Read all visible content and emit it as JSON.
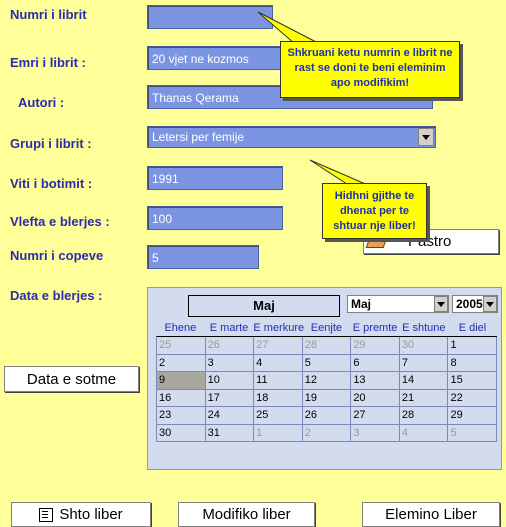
{
  "form": {
    "book_number_label": "Numri i  librit",
    "book_number_value": "",
    "book_name_label": "Emri i librit :",
    "book_name_value": "20 vjet ne kozmos",
    "author_label": "Autori :",
    "author_value": "Thanas Qerama",
    "group_label": "Grupi i librit :",
    "group_value": "Letersi per femije",
    "year_label": "Viti i botimit :",
    "year_value": "1991",
    "price_label": "Vlefta e blerjes :",
    "price_value": "100",
    "copies_label": "Numri i copeve",
    "copies_value": "5",
    "purchase_date_label": "Data e blerjes :"
  },
  "tooltips": {
    "top": "Shkruani ketu numrin e librit ne rast se doni te beni eleminim apo modifikim!",
    "bottom": "Hidhni gjithe te dhenat per te shtuar nje liber!"
  },
  "buttons": {
    "clear": "Pastro",
    "today": "Data e sotme",
    "add": "Shto liber",
    "modify": "Modifiko liber",
    "delete": "Elemino  Liber"
  },
  "calendar": {
    "title": "Maj",
    "month_select": "Maj",
    "year_select": "2005",
    "weekdays": [
      "Ehene",
      "E marte",
      "E merkure",
      "Eenjte",
      "E premte",
      "E shtune",
      "E diel"
    ],
    "weeks": [
      [
        {
          "d": "25",
          "o": true
        },
        {
          "d": "26",
          "o": true
        },
        {
          "d": "27",
          "o": true
        },
        {
          "d": "28",
          "o": true
        },
        {
          "d": "29",
          "o": true
        },
        {
          "d": "30",
          "o": true
        },
        {
          "d": "1",
          "o": false
        }
      ],
      [
        {
          "d": "2",
          "o": false
        },
        {
          "d": "3",
          "o": false
        },
        {
          "d": "4",
          "o": false
        },
        {
          "d": "5",
          "o": false
        },
        {
          "d": "6",
          "o": false
        },
        {
          "d": "7",
          "o": false
        },
        {
          "d": "8",
          "o": false
        }
      ],
      [
        {
          "d": "9",
          "o": false,
          "s": true
        },
        {
          "d": "10",
          "o": false
        },
        {
          "d": "11",
          "o": false
        },
        {
          "d": "12",
          "o": false
        },
        {
          "d": "13",
          "o": false
        },
        {
          "d": "14",
          "o": false
        },
        {
          "d": "15",
          "o": false
        }
      ],
      [
        {
          "d": "16",
          "o": false
        },
        {
          "d": "17",
          "o": false
        },
        {
          "d": "18",
          "o": false
        },
        {
          "d": "19",
          "o": false
        },
        {
          "d": "20",
          "o": false
        },
        {
          "d": "21",
          "o": false
        },
        {
          "d": "22",
          "o": false
        }
      ],
      [
        {
          "d": "23",
          "o": false
        },
        {
          "d": "24",
          "o": false
        },
        {
          "d": "25",
          "o": false
        },
        {
          "d": "26",
          "o": false
        },
        {
          "d": "27",
          "o": false
        },
        {
          "d": "28",
          "o": false
        },
        {
          "d": "29",
          "o": false
        }
      ],
      [
        {
          "d": "30",
          "o": false
        },
        {
          "d": "31",
          "o": false
        },
        {
          "d": "1",
          "o": true
        },
        {
          "d": "2",
          "o": true
        },
        {
          "d": "3",
          "o": true
        },
        {
          "d": "4",
          "o": true
        },
        {
          "d": "5",
          "o": true
        }
      ]
    ]
  },
  "colors": {
    "background": "#FFFF99",
    "field": "#7B95E3",
    "label": "#2B2BB0",
    "tooltip": "#FFFF00",
    "calendar": "#D3DCEF"
  }
}
